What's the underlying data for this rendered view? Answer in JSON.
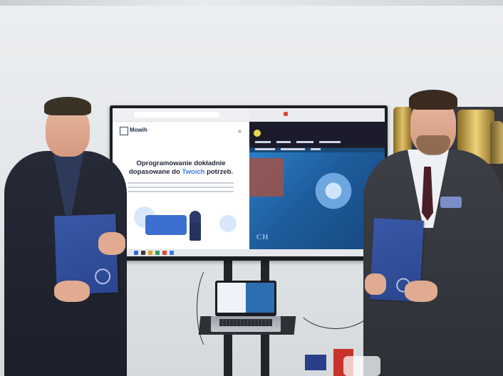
{
  "screen": {
    "left_site": {
      "logo_text": "Mowih",
      "hero_title_line1": "Oprogramowanie dokładnie",
      "hero_title_pre": "dopasowane do ",
      "hero_title_accent": "Twoich",
      "hero_title_post": " potrzeb."
    },
    "right_site": {
      "overlay_text": "CH"
    }
  },
  "colors": {
    "tv_frame": "#1b1d22",
    "accent_blue": "#3b79e0",
    "folder_blue": "#2f4c9a"
  }
}
